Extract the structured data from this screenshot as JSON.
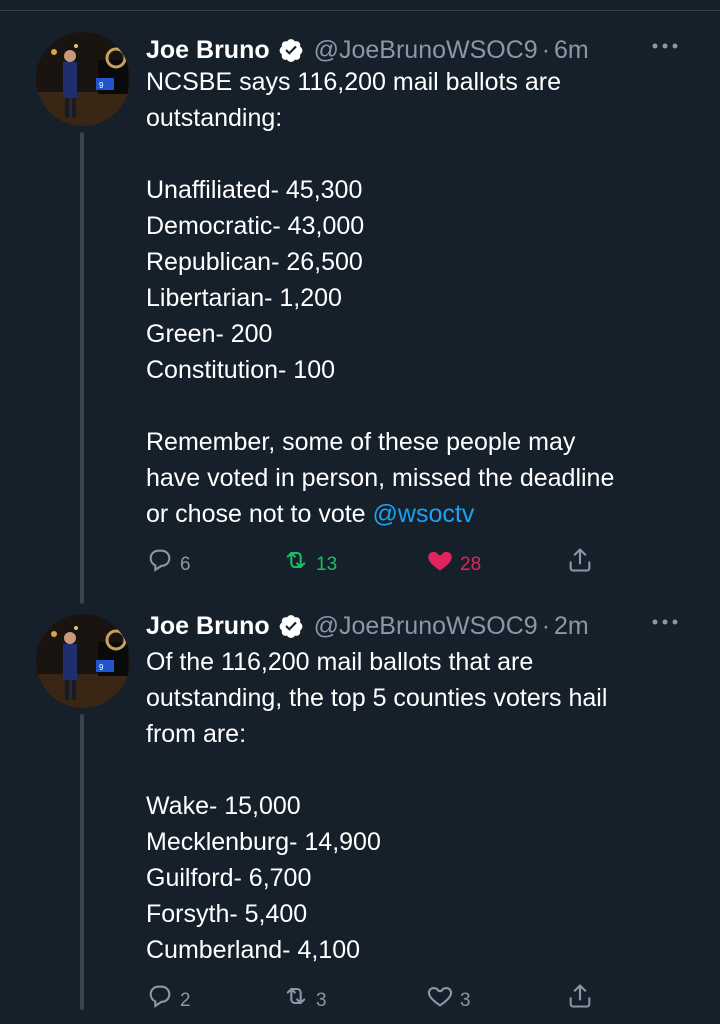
{
  "tweets": [
    {
      "name": "Joe Bruno",
      "handle": "@JoeBrunoWSOC9",
      "separator": "·",
      "time": "6m",
      "paragraphs": [
        {
          "lines": [
            "NCSBE says 116,200 mail ballots are",
            "outstanding:"
          ]
        },
        {
          "lines": [
            "Unaffiliated- 45,300",
            "Democratic- 43,000",
            "Republican- 26,500",
            "Libertarian- 1,200",
            "Green- 200",
            "Constitution- 100"
          ]
        },
        {
          "lines": [
            "Remember, some of these people may",
            "have voted in person, missed the deadline"
          ],
          "last_line": "or chose not to vote ",
          "mention": "@wsoctv"
        }
      ],
      "replies": "6",
      "retweets": "13",
      "likes": "28",
      "retweet_active": true,
      "like_active": true
    },
    {
      "name": "Joe Bruno",
      "handle": "@JoeBrunoWSOC9",
      "separator": "·",
      "time": "2m",
      "paragraphs": [
        {
          "lines": [
            "Of the 116,200 mail ballots that are",
            "outstanding, the top 5 counties voters hail",
            "from are:"
          ]
        },
        {
          "lines": [
            "Wake- 15,000",
            "Mecklenburg- 14,900",
            "Guilford- 6,700",
            "Forsyth- 5,400",
            "Cumberland- 4,100"
          ]
        }
      ],
      "replies": "2",
      "retweets": "3",
      "likes": "3",
      "retweet_active": false,
      "like_active": false
    }
  ],
  "icons": {
    "verified": "verified-badge-icon",
    "more": "more-icon",
    "reply": "reply-icon",
    "retweet": "retweet-icon",
    "like": "heart-icon",
    "share": "share-icon"
  },
  "colors": {
    "background": "#15202b",
    "text": "#ffffff",
    "secondary": "#8899a6",
    "link": "#1da1f2",
    "retweet_active": "#17bf63",
    "like_active": "#e0245e"
  }
}
